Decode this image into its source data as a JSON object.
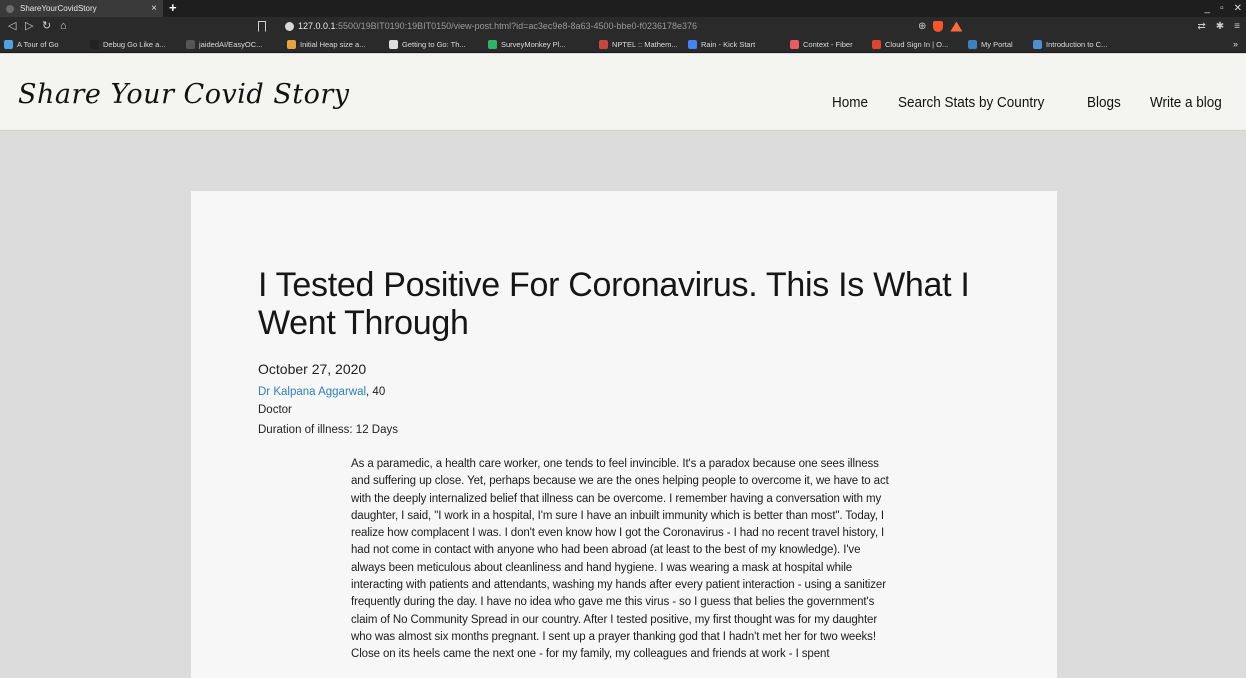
{
  "browser": {
    "tab_title": "ShareYourCovidStory",
    "tab_close": "×",
    "new_tab": "+",
    "url_host": "127.0.0.1",
    "url_rest": ":5500/19BIT0190:19BIT0150/view-post.html?id=ac3ec9e8-8a63-4500-bbe0-f0236178e376",
    "window_controls": [
      "_",
      "▫",
      "✕"
    ],
    "bookmarks": [
      {
        "label": "A Tour of Go",
        "color": "#4fa3e0"
      },
      {
        "label": "Debug Go Like a...",
        "color": "#222222"
      },
      {
        "label": "jaidedAI/EasyOC...",
        "color": "#555555"
      },
      {
        "label": "Initial Heap size a...",
        "color": "#e8a33a"
      },
      {
        "label": "Getting to Go: Th...",
        "color": "#dddddd"
      },
      {
        "label": "SurveyMonkey Pl...",
        "color": "#2fb36b"
      },
      {
        "label": "NPTEL :: Mathem...",
        "color": "#c7463d"
      },
      {
        "label": "Rain - Kick Start",
        "color": "#4285f4"
      },
      {
        "label": "Context - Fiber",
        "color": "#e85d64"
      },
      {
        "label": "Cloud Sign In | O...",
        "color": "#e0442e"
      },
      {
        "label": "My Portal",
        "color": "#3b82c4"
      },
      {
        "label": "Introduction to C...",
        "color": "#4d8fd1"
      }
    ],
    "bookmarks_more": "»"
  },
  "site": {
    "brand": "Share Your Covid Story",
    "nav": [
      "Home",
      "Search Stats by Country",
      "Blogs",
      "Write a blog"
    ]
  },
  "post": {
    "title": "I Tested Positive For Coronavirus. This Is What I Went Through",
    "date": "October 27, 2020",
    "author": "Dr Kalpana Aggarwal",
    "age": ", 40",
    "profession": "Doctor",
    "duration": "Duration of illness: 12 Days",
    "body": "As a paramedic, a health care worker, one tends to feel invincible. It's a paradox because one sees illness and suffering up close. Yet, perhaps because we are the ones helping people to overcome it, we have to act with the deeply internalized belief that illness can be overcome. I remember having a conversation with my daughter, I said, \"I work in a hospital, I'm sure I have an inbuilt immunity which is better than most\". Today, I realize how complacent I was. I don't even know how I got the Coronavirus - I had no recent travel history, I had not come in contact with anyone who had been abroad (at least to the best of my knowledge). I've always been meticulous about cleanliness and hand hygiene. I was wearing a mask at hospital while interacting with patients and attendants, washing my hands after every patient interaction - using a sanitizer frequently during the day. I have no idea who gave me this virus - so I guess that belies the government's claim of No Community Spread in our country. After I tested positive, my first thought was for my daughter who was almost six months pregnant. I sent up a prayer thanking god that I hadn't met her for two weeks! Close on its heels came the next one - for my family, my colleagues and friends at work - I spent"
  }
}
